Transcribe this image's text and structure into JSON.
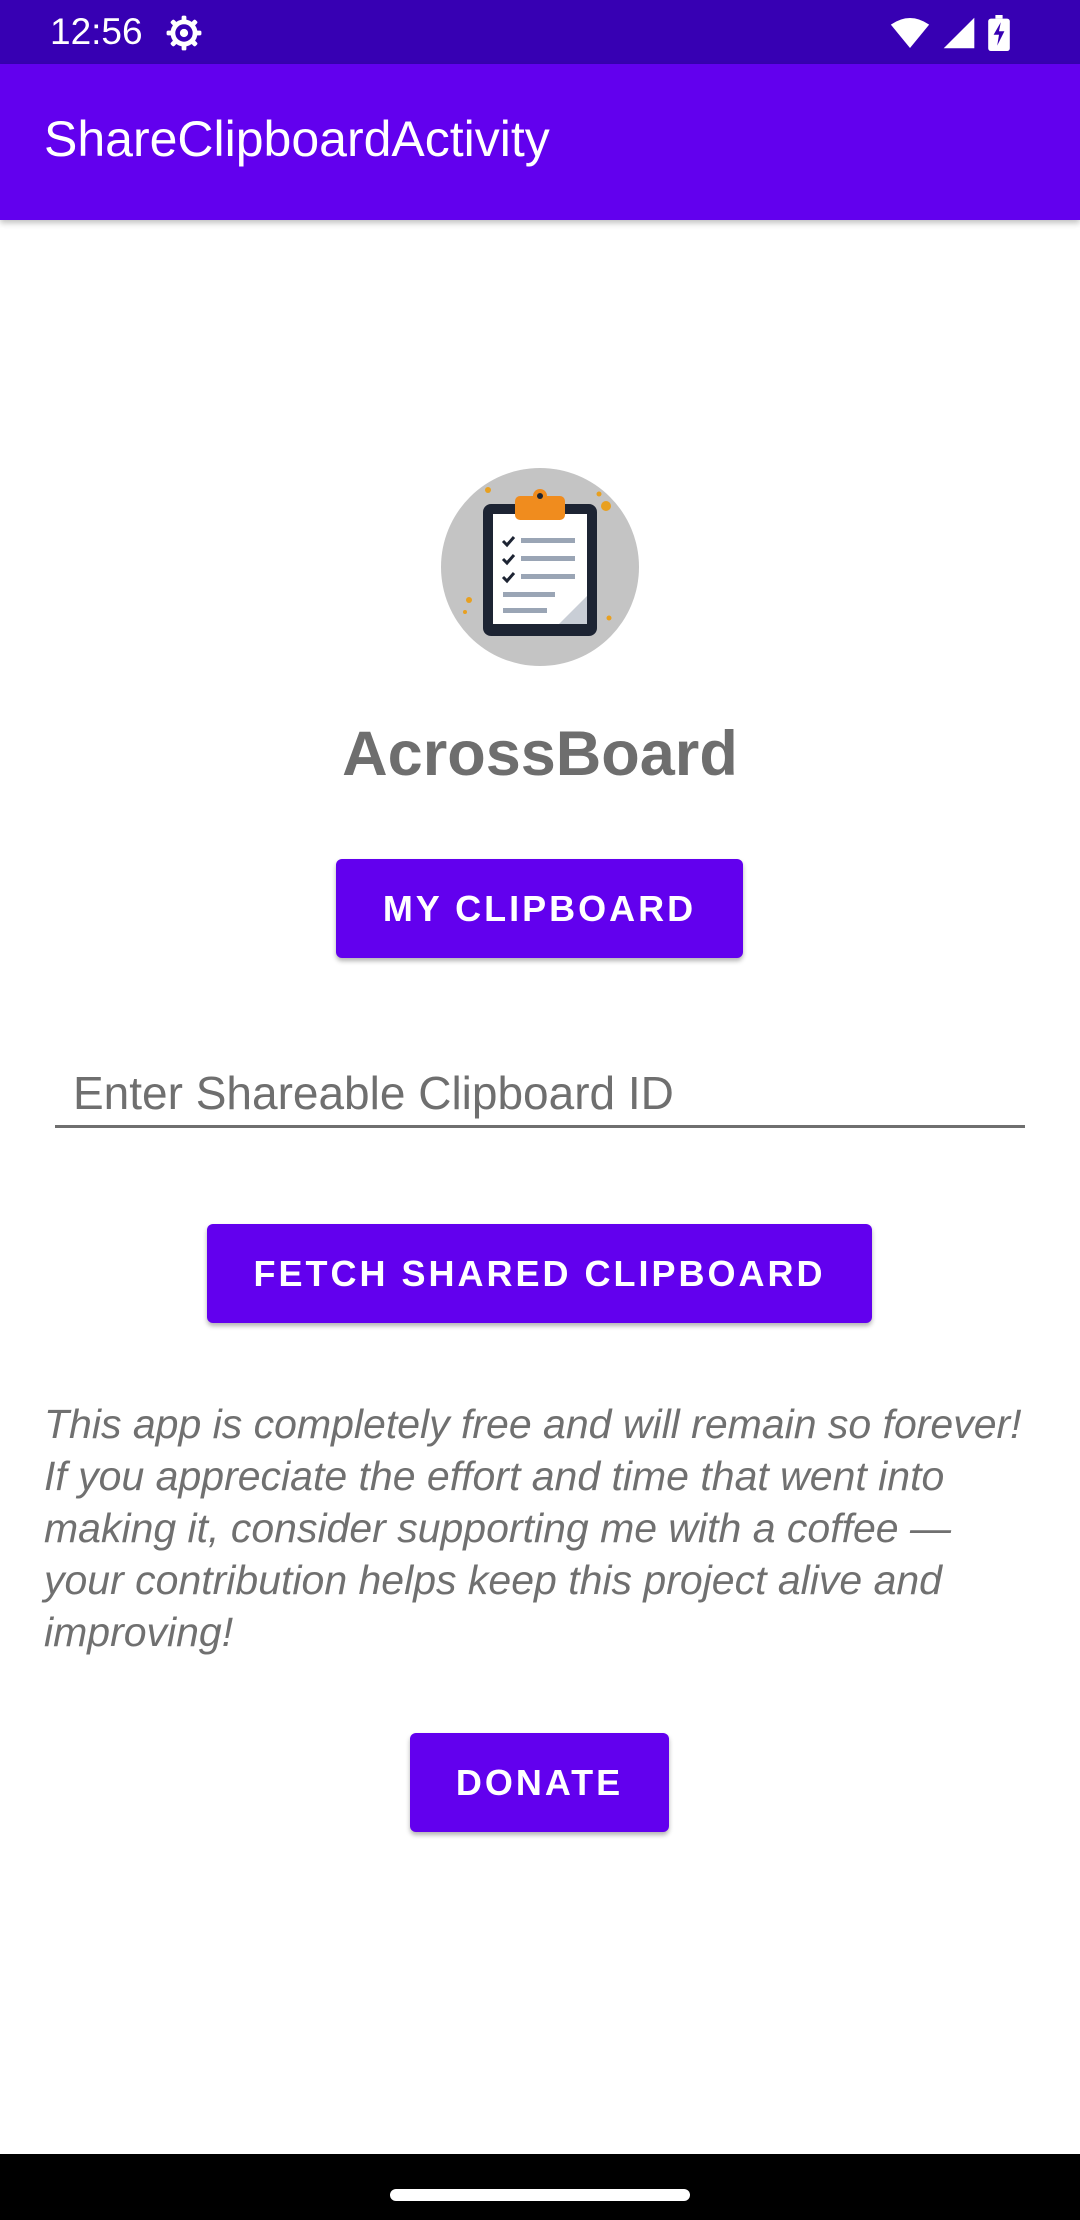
{
  "status_bar": {
    "time": "12:56",
    "icons": [
      "settings-gear-icon",
      "wifi-icon",
      "cellular-signal-icon",
      "battery-charging-icon"
    ]
  },
  "app_bar": {
    "title": "ShareClipboardActivity"
  },
  "main": {
    "logo_icon": "clipboard-checklist-icon",
    "app_name": "AcrossBoard",
    "my_clipboard_label": "My Clipboard",
    "clipboard_id_input": {
      "value": "",
      "placeholder": "Enter Shareable Clipboard ID"
    },
    "fetch_label": "Fetch Shared Clipboard",
    "support_text": "This app is completely free and will remain so forever! If you appreciate the effort and time that went into making it, consider supporting me with a coffee — your contribution helps keep this project alive and improving!",
    "donate_label": "Donate"
  },
  "colors": {
    "status_bar": "#3700b3",
    "primary": "#6200ee",
    "heading_gray": "#6e6e6e",
    "body_gray": "#707070"
  }
}
